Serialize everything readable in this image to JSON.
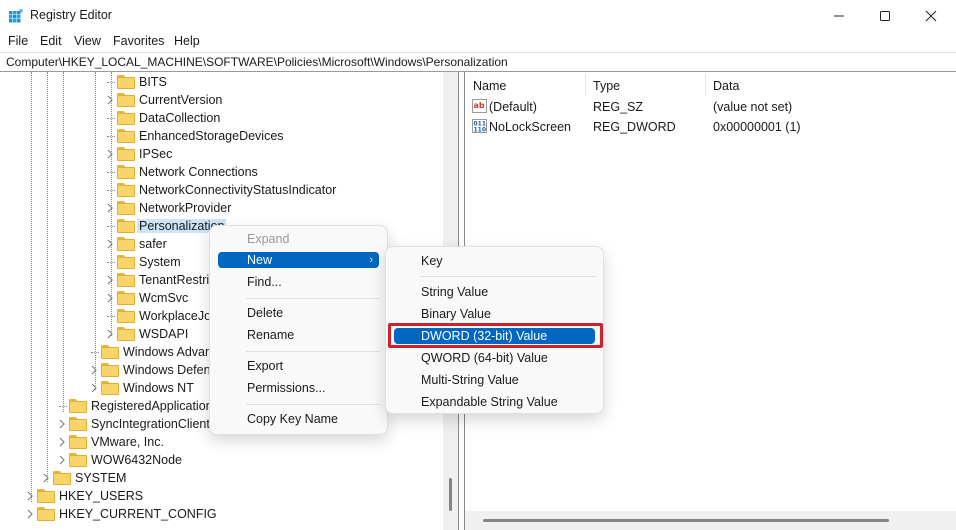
{
  "window": {
    "title": "Registry Editor",
    "icon": "registry-editor-icon",
    "controls": [
      "minimize-icon",
      "maximize-icon",
      "close-icon"
    ]
  },
  "menu": [
    "File",
    "Edit",
    "View",
    "Favorites",
    "Help"
  ],
  "address": "Computer\\HKEY_LOCAL_MACHINE\\SOFTWARE\\Policies\\Microsoft\\Windows\\Personalization",
  "tree": {
    "windows_children": [
      {
        "label": "BITS",
        "expandable": false
      },
      {
        "label": "CurrentVersion",
        "expandable": true
      },
      {
        "label": "DataCollection",
        "expandable": false
      },
      {
        "label": "EnhancedStorageDevices",
        "expandable": false
      },
      {
        "label": "IPSec",
        "expandable": true
      },
      {
        "label": "Network Connections",
        "expandable": false
      },
      {
        "label": "NetworkConnectivityStatusIndicator",
        "expandable": false
      },
      {
        "label": "NetworkProvider",
        "expandable": true
      },
      {
        "label": "Personalization",
        "expandable": false,
        "selected": true
      },
      {
        "label": "safer",
        "expandable": true
      },
      {
        "label": "System",
        "expandable": false
      },
      {
        "label": "TenantRestrictions",
        "expandable": true
      },
      {
        "label": "WcmSvc",
        "expandable": true
      },
      {
        "label": "WorkplaceJoin",
        "expandable": false
      },
      {
        "label": "WSDAPI",
        "expandable": true
      }
    ],
    "microsoft_children": [
      {
        "label": "Windows Advanced Threat Protection",
        "expandable": false
      },
      {
        "label": "Windows Defender",
        "expandable": true
      },
      {
        "label": "Windows NT",
        "expandable": true
      }
    ],
    "software_children": [
      {
        "label": "RegisteredApplications",
        "expandable": false
      },
      {
        "label": "SyncIntegrationClients",
        "expandable": true
      },
      {
        "label": "VMware, Inc.",
        "expandable": true
      },
      {
        "label": "WOW6432Node",
        "expandable": true
      }
    ],
    "hklm_children": [
      {
        "label": "SYSTEM",
        "expandable": true
      }
    ],
    "roots": [
      {
        "label": "HKEY_USERS",
        "expandable": true
      },
      {
        "label": "HKEY_CURRENT_CONFIG",
        "expandable": true
      }
    ]
  },
  "values": {
    "columns": [
      "Name",
      "Type",
      "Data"
    ],
    "rows": [
      {
        "icon": "string-value-icon",
        "name": "(Default)",
        "type": "REG_SZ",
        "data": "(value not set)"
      },
      {
        "icon": "binary-value-icon",
        "name": "NoLockScreen",
        "type": "REG_DWORD",
        "data": "0x00000001 (1)"
      }
    ]
  },
  "context_menu": {
    "items": [
      {
        "label": "Expand",
        "disabled": true
      },
      {
        "label": "New",
        "hover": true,
        "submenu": true
      },
      {
        "label": "Find..."
      },
      {
        "label": "Delete"
      },
      {
        "label": "Rename"
      },
      {
        "label": "Export"
      },
      {
        "label": "Permissions..."
      },
      {
        "label": "Copy Key Name"
      }
    ]
  },
  "submenu": {
    "items": [
      {
        "label": "Key"
      },
      {
        "label": "String Value"
      },
      {
        "label": "Binary Value"
      },
      {
        "label": "DWORD (32-bit) Value",
        "hover": true,
        "highlighted": true
      },
      {
        "label": "QWORD (64-bit) Value"
      },
      {
        "label": "Multi-String Value"
      },
      {
        "label": "Expandable String Value"
      }
    ]
  },
  "colors": {
    "accent": "#0067c0",
    "highlight_box": "#d0202a",
    "selection": "#cce4f7",
    "folder": "#f8d56b"
  }
}
